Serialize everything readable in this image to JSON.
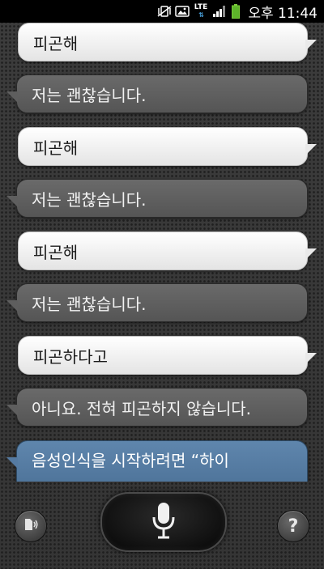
{
  "status_bar": {
    "network": "LTE",
    "ampm": "오후",
    "time": "11:44"
  },
  "messages": [
    {
      "role": "user",
      "text": "피곤해"
    },
    {
      "role": "assistant",
      "text": "저는 괜찮습니다."
    },
    {
      "role": "user",
      "text": "피곤해"
    },
    {
      "role": "assistant",
      "text": "저는 괜찮습니다."
    },
    {
      "role": "user",
      "text": "피곤해"
    },
    {
      "role": "assistant",
      "text": "저는 괜찮습니다."
    },
    {
      "role": "user",
      "text": "피곤하다고"
    },
    {
      "role": "assistant",
      "text": "아니요. 전혀 피곤하지 않습니다."
    },
    {
      "role": "hint",
      "text": "음성인식을 시작하려면 “하이"
    }
  ],
  "controls": {
    "help_label": "?",
    "mic_icon": "microphone-icon",
    "speaker_icon": "speaker-output-icon"
  },
  "colors": {
    "user_bubble": "#f2f2f2",
    "assistant_bubble": "#5f5f5f",
    "hint_bubble": "#557aa1"
  }
}
